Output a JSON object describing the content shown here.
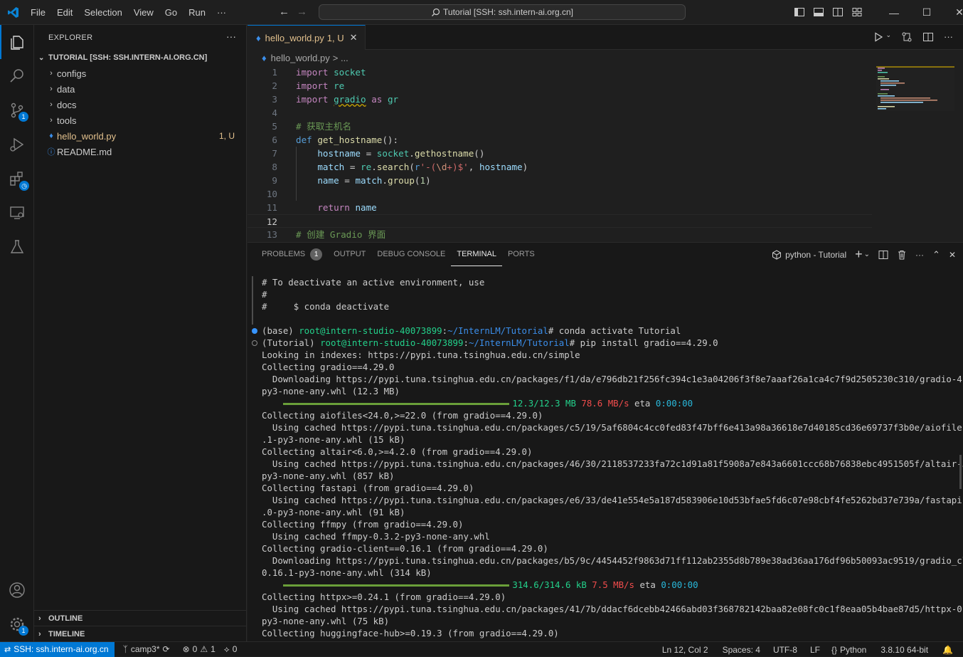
{
  "titlebar": {
    "menu": [
      "File",
      "Edit",
      "Selection",
      "View",
      "Go",
      "Run",
      "···"
    ],
    "command_center": "Tutorial [SSH: ssh.intern-ai.org.cn]"
  },
  "activity": {
    "source_control_badge": "1",
    "accounts_badge": "1"
  },
  "sidebar": {
    "title": "EXPLORER",
    "root": "TUTORIAL [SSH: SSH.INTERN-AI.ORG.CN]",
    "items": [
      {
        "label": "configs"
      },
      {
        "label": "data"
      },
      {
        "label": "docs"
      },
      {
        "label": "tools"
      },
      {
        "label": "hello_world.py",
        "status": "1, U"
      },
      {
        "label": "README.md"
      }
    ],
    "outline": "OUTLINE",
    "timeline": "TIMELINE"
  },
  "editor": {
    "tab_label": "hello_world.py",
    "tab_status": "1, U",
    "breadcrumb_file": "hello_world.py",
    "breadcrumb_rest": "> ...",
    "line_numbers": [
      "1",
      "2",
      "3",
      "4",
      "5",
      "6",
      "7",
      "8",
      "9",
      "10",
      "11",
      "12",
      "13"
    ]
  },
  "panel": {
    "tabs": [
      "PROBLEMS",
      "OUTPUT",
      "DEBUG CONSOLE",
      "TERMINAL",
      "PORTS"
    ],
    "problems_count": "1",
    "terminal_name": "python - Tutorial",
    "lines": [
      "# To deactivate an active environment, use",
      "#",
      "#     $ conda deactivate",
      "",
      "(base) ",
      "root@intern-studio-40073899",
      ":",
      "~/InternLM/Tutorial",
      "# conda activate Tutorial",
      "(Tutorial) ",
      "# pip install gradio==4.29.0",
      "Looking in indexes: https://pypi.tuna.tsinghua.edu.cn/simple",
      "Collecting gradio==4.29.0",
      "  Downloading https://pypi.tuna.tsinghua.edu.cn/packages/f1/da/e796db21f256fc394c1e3a04206f3f8e7aaaf26a1ca4c7f9d2505230c310/gradio-4.29.0-",
      "py3-none-any.whl (12.3 MB)",
      "12.3/12.3 MB",
      "78.6 MB/s",
      "eta",
      "0:00:00",
      "Collecting aiofiles<24.0,>=22.0 (from gradio==4.29.0)",
      "  Using cached https://pypi.tuna.tsinghua.edu.cn/packages/c5/19/5af6804c4cc0fed83f47bff6e413a98a36618e7d40185cd36e69737f3b0e/aiofiles-23.2",
      ".1-py3-none-any.whl (15 kB)",
      "Collecting altair<6.0,>=4.2.0 (from gradio==4.29.0)",
      "  Using cached https://pypi.tuna.tsinghua.edu.cn/packages/46/30/2118537233fa72c1d91a81f5908a7e843a6601ccc68b76838ebc4951505f/altair-5.3.0-",
      "py3-none-any.whl (857 kB)",
      "Collecting fastapi (from gradio==4.29.0)",
      "  Using cached https://pypi.tuna.tsinghua.edu.cn/packages/e6/33/de41e554e5a187d583906e10d53bfae5fd6c07e98cbf4fe5262bd37e739a/fastapi-0.111",
      ".0-py3-none-any.whl (91 kB)",
      "Collecting ffmpy (from gradio==4.29.0)",
      "  Using cached ffmpy-0.3.2-py3-none-any.whl",
      "Collecting gradio-client==0.16.1 (from gradio==4.29.0)",
      "  Downloading https://pypi.tuna.tsinghua.edu.cn/packages/b5/9c/4454452f9863d71ff112ab2355d8b789e38ad36aa176df96b50093ac9519/gradio_client-",
      "0.16.1-py3-none-any.whl (314 kB)",
      "314.6/314.6 kB",
      "7.5 MB/s",
      "Collecting httpx>=0.24.1 (from gradio==4.29.0)",
      "  Using cached https://pypi.tuna.tsinghua.edu.cn/packages/41/7b/ddacf6dcebb42466abd03f368782142baa82e08fc0c1f8eaa05b4bae87d5/httpx-0.27.0-",
      "py3-none-any.whl (75 kB)",
      "Collecting huggingface-hub>=0.19.3 (from gradio==4.29.0)"
    ]
  },
  "statusbar": {
    "remote": "SSH: ssh.intern-ai.org.cn",
    "branch": "camp3*",
    "errors": "0",
    "warnings": "1",
    "ports": "0",
    "position": "Ln 12, Col 2",
    "spaces": "Spaces: 4",
    "encoding": "UTF-8",
    "eol": "LF",
    "language": "Python",
    "interpreter": "3.8.10 64-bit"
  },
  "colors": {
    "accent": "#0078d4",
    "modified": "#e2c08d",
    "terminal_green": "#23d18b",
    "terminal_blue": "#3b8eea",
    "terminal_red": "#f14c4c",
    "progress": "#6a9f39"
  }
}
